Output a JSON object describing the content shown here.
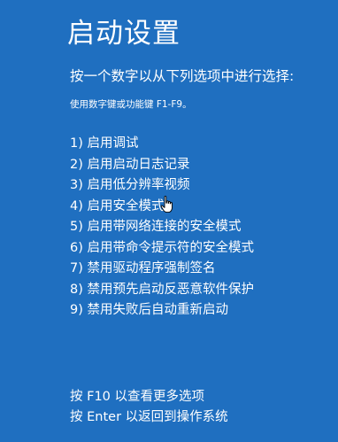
{
  "title": "启动设置",
  "subtitle": "按一个数字以从下列选项中进行选择:",
  "hint": "使用数字键或功能键 F1-F9。",
  "options": [
    "1) 启用调试",
    "2) 启用启动日志记录",
    "3) 启用低分辨率视频",
    "4) 启用安全模式",
    "5) 启用带网络连接的安全模式",
    "6) 启用带命令提示符的安全模式",
    "7) 禁用驱动程序强制签名",
    "8) 禁用预先启动反恶意软件保护",
    "9) 禁用失败后自动重新启动"
  ],
  "footer": {
    "more_options": "按 F10 以查看更多选项",
    "return": "按 Enter 以返回到操作系统"
  },
  "colors": {
    "background": "#1f6fc0",
    "text": "#ffffff"
  },
  "cursor_icon": "hand-pointer-icon"
}
